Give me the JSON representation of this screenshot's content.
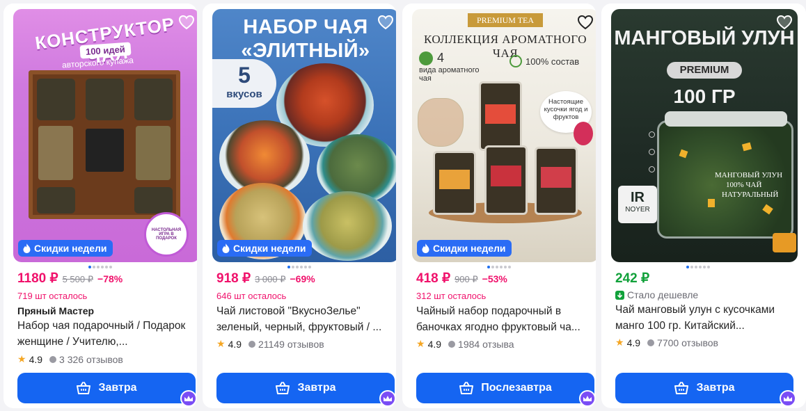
{
  "products": [
    {
      "price": "1180 ₽",
      "old_price": "5 500 ₽",
      "discount": "−78%",
      "stock": "719 шт осталось",
      "brand": "Пряный Мастер",
      "title": "Набор чая подарочный / Подарок женщине / Учителю,...",
      "rating": "4.9",
      "reviews": "3 326 отзывов",
      "promo": "Скидки недели",
      "cart": "Завтра",
      "photo": {
        "headline": "КОНСТРУКТОР ЧАЯ",
        "pill": "100 идей",
        "sub": "авторского купажа",
        "sticker": "НАСТОЛЬНАЯ ИГРА В ПОДАРОК"
      }
    },
    {
      "price": "918 ₽",
      "old_price": "3 000 ₽",
      "discount": "−69%",
      "stock": "646 шт осталось",
      "title": "Чай листовой \"ВкусноЗелье\" зеленый, черный, фруктовый / ...",
      "rating": "4.9",
      "reviews": "21149 отзывов",
      "promo": "Скидки недели",
      "cart": "Завтра",
      "photo": {
        "line1": "НАБОР ЧАЯ",
        "line2": "«ЭЛИТНЫЙ»",
        "count": "5",
        "count_label": "вкусов"
      }
    },
    {
      "price": "418 ₽",
      "old_price": "900 ₽",
      "discount": "−53%",
      "stock": "312 шт осталось",
      "title": "Чайный набор подарочный в баночках ягодно фруктовый ча...",
      "rating": "4.9",
      "reviews": "1984 отзыва",
      "promo": "Скидки недели",
      "cart": "Послезавтра",
      "photo": {
        "ribbon": "PREMIUM TEA",
        "headline": "КОЛЛЕКЦИЯ АРОМАТНОГО ЧАЯ",
        "feat1_num": "4",
        "feat1": "вида ароматного чая",
        "feat2": "100% состав",
        "callout": "Настоящие кусочки ягод и фруктов"
      }
    },
    {
      "price": "242 ₽",
      "cheaper": "Стало дешевле",
      "title": "Чай манговый улун с кусочками манго 100 гр. Китайский...",
      "rating": "4.9",
      "reviews": "7700 отзывов",
      "cart": "Завтра",
      "photo": {
        "headline": "МАНГОВЫЙ УЛУН",
        "pill": "PREMIUM",
        "weight": "100 ГР",
        "label1": "МАНГОВЫЙ УЛУН",
        "label2": "100% ЧАЙ",
        "label3": "НАТУРАЛЬНЫЙ",
        "brand": "NOYER",
        "logo": "IR"
      }
    }
  ]
}
